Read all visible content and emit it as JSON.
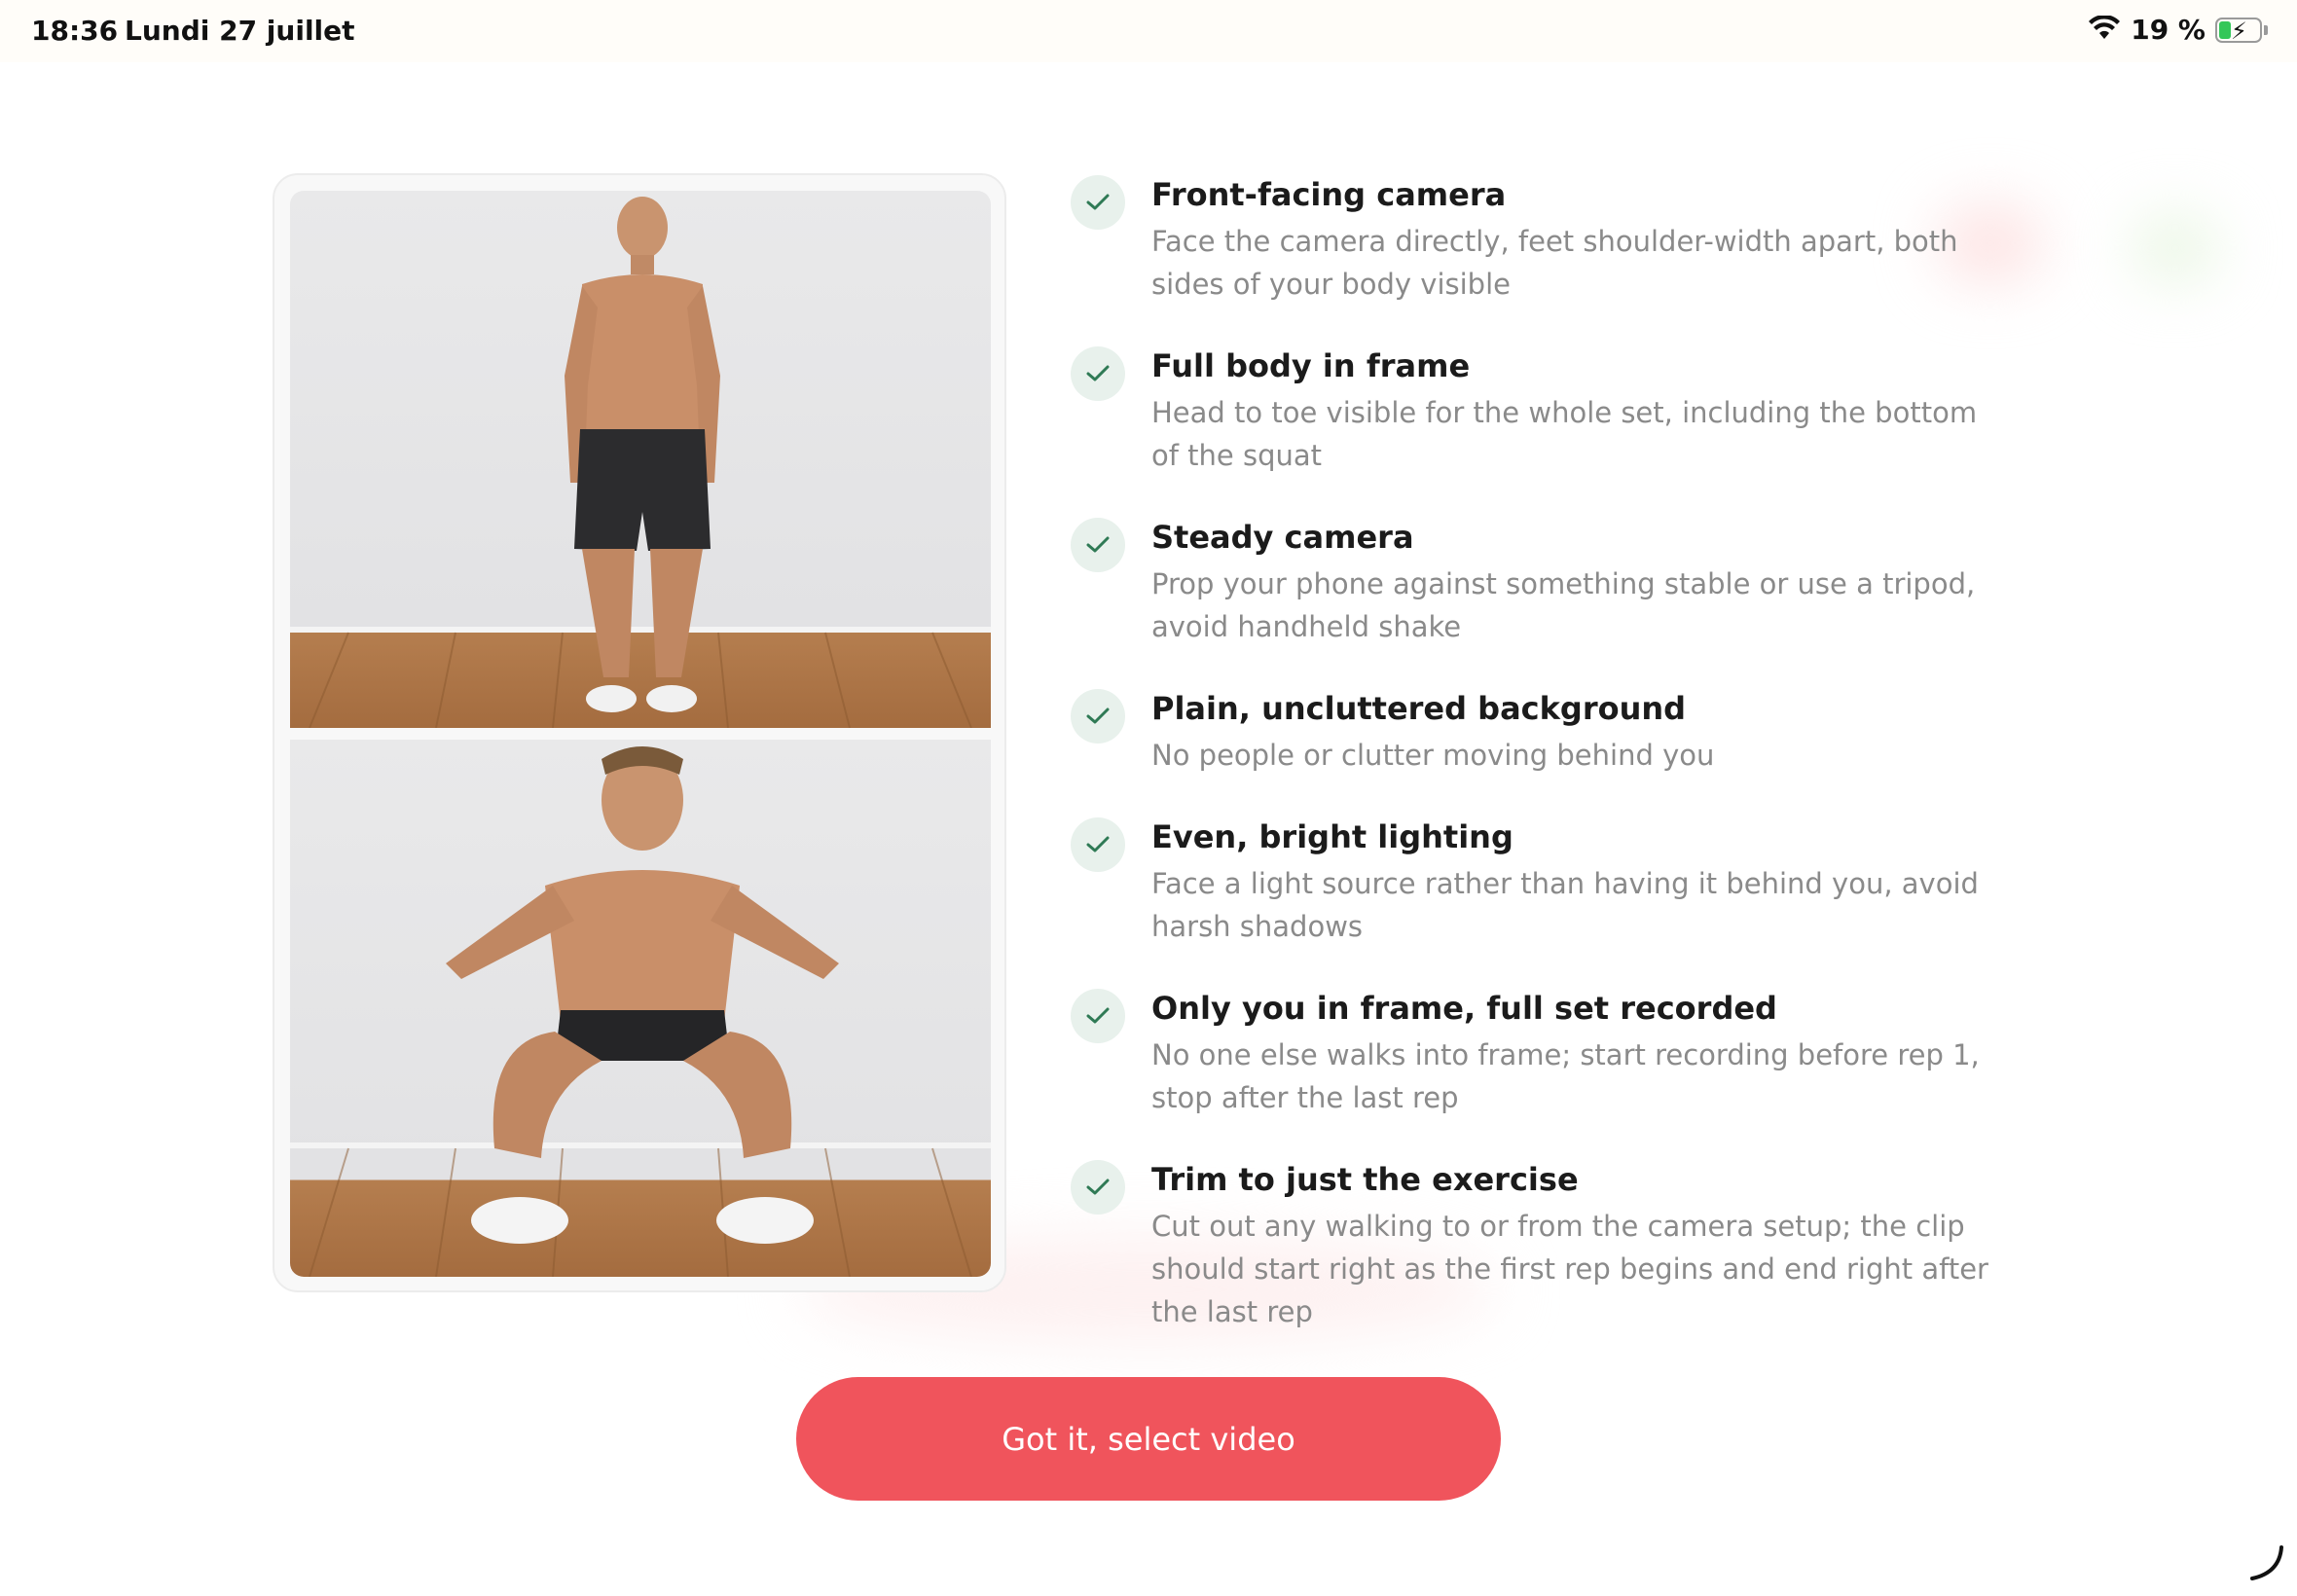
{
  "status_bar": {
    "time": "18:36",
    "date": "Lundi 27 juillet",
    "battery": "19 %",
    "icons": [
      "wifi-icon",
      "battery-charging-icon"
    ]
  },
  "images": [
    {
      "name": "standing-photo",
      "alt": "Man standing facing camera, feet shoulder-width apart"
    },
    {
      "name": "squat-photo",
      "alt": "Man in deep squat with arms extended forward"
    }
  ],
  "checklist": [
    {
      "title": "Front-facing camera",
      "description": "Face the camera directly, feet shoulder-width apart, both sides of your body visible"
    },
    {
      "title": "Full body in frame",
      "description": "Head to toe visible for the whole set, including the bottom of the squat"
    },
    {
      "title": "Steady camera",
      "description": "Prop your phone against something stable or use a tripod, avoid handheld shake"
    },
    {
      "title": "Plain, uncluttered background",
      "description": "No people or clutter moving behind you"
    },
    {
      "title": "Even, bright lighting",
      "description": "Face a light source rather than having it behind you, avoid harsh shadows"
    },
    {
      "title": "Only you in frame, full set recorded",
      "description": "No one else walks into frame; start recording before rep 1, stop after the last rep"
    },
    {
      "title": "Trim to just the exercise",
      "description": "Cut out any walking to or from the camera setup; the clip should start right as the first rep begins and end right after the last rep"
    }
  ],
  "cta": {
    "label": "Got it, select video"
  },
  "colors": {
    "accent": "#f0545c",
    "check_bg": "#e8f1ec",
    "check_mark": "#2f7a55",
    "muted_text": "#8a8a8a"
  }
}
